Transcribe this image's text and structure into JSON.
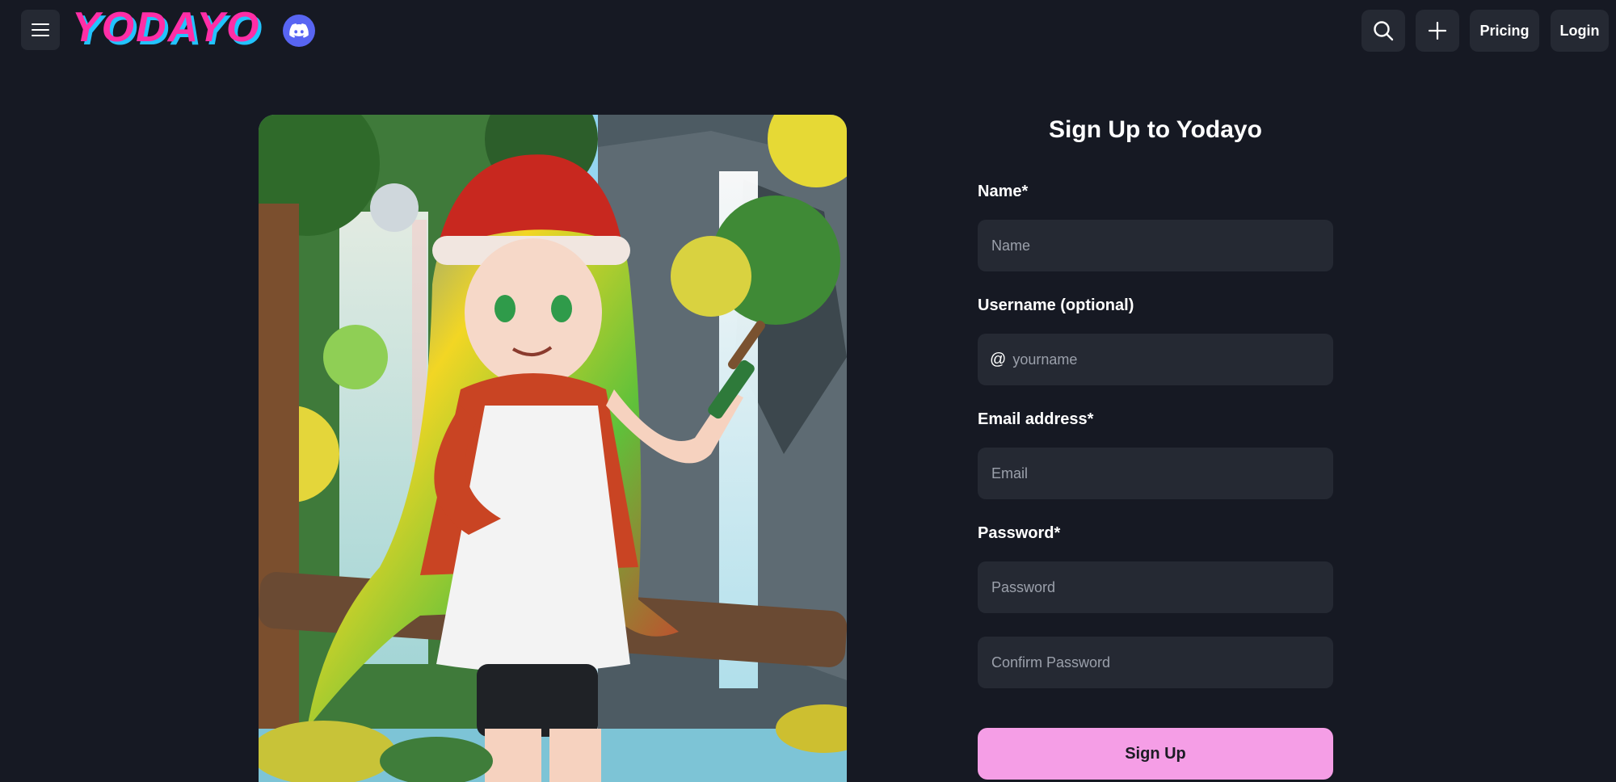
{
  "header": {
    "logo_text": "YODAYO",
    "pricing_label": "Pricing",
    "login_label": "Login",
    "icons": {
      "menu": "hamburger-menu-icon",
      "discord": "discord-icon",
      "search": "search-icon",
      "create": "plus-icon"
    }
  },
  "form": {
    "title": "Sign Up to Yodayo",
    "name": {
      "label": "Name*",
      "placeholder": "Name"
    },
    "username": {
      "label": "Username (optional)",
      "prefix": "@",
      "placeholder": "yourname"
    },
    "email": {
      "label": "Email address*",
      "placeholder": "Email"
    },
    "password": {
      "label": "Password*",
      "placeholder": "Password"
    },
    "confirm_password": {
      "placeholder": "Confirm Password"
    },
    "submit_label": "Sign Up"
  },
  "colors": {
    "background": "#161923",
    "surface": "#252933",
    "accent_pink": "#f59ee6",
    "logo_pink": "#ff2ea6",
    "logo_cyan": "#22c3ff",
    "discord": "#5865f2"
  }
}
